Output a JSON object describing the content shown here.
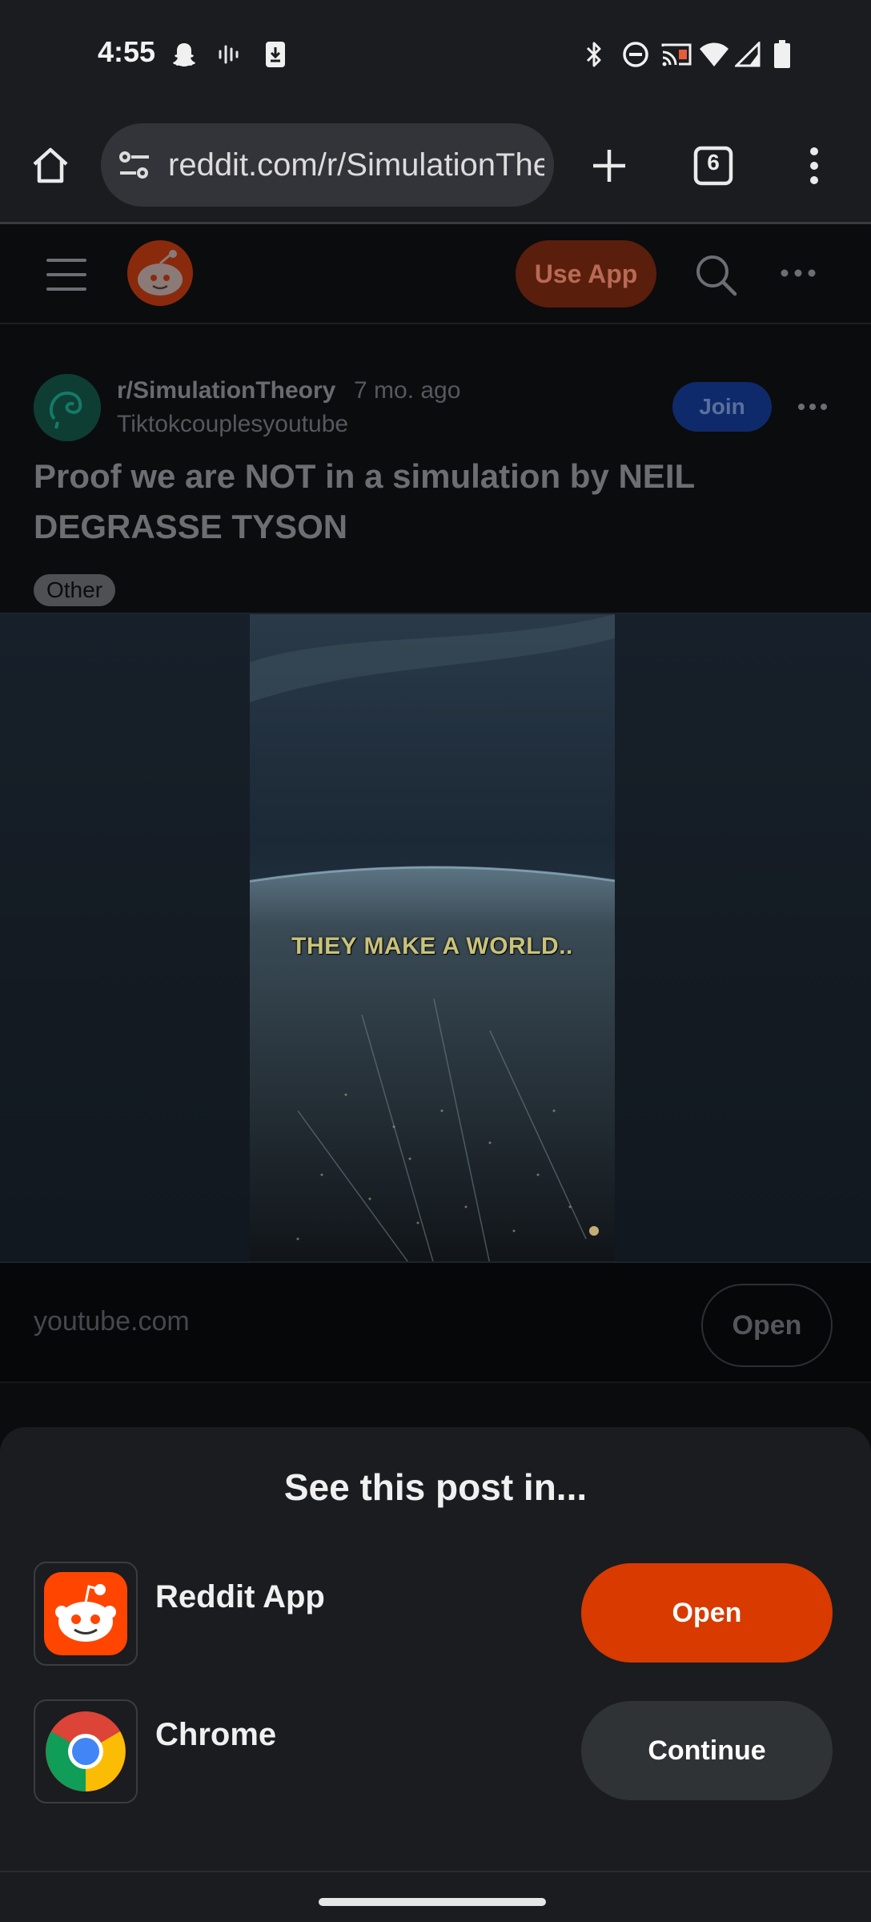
{
  "status_bar": {
    "time": "4:55",
    "left_icons": [
      "snapchat-icon",
      "voice-recorder-icon",
      "download-icon"
    ],
    "right_icons": [
      "bluetooth-icon",
      "do-not-disturb-icon",
      "cast-icon",
      "wifi-icon",
      "signal-icon",
      "battery-icon"
    ]
  },
  "browser": {
    "url": "reddit.com/r/SimulationTheory",
    "tab_count": "6",
    "icons": [
      "home-icon",
      "site-settings-icon",
      "new-tab-icon",
      "tab-switcher-icon",
      "menu-icon"
    ]
  },
  "reddit_header": {
    "use_app_label": "Use App"
  },
  "post": {
    "subreddit": "r/SimulationTheory",
    "age": "7 mo. ago",
    "author": "Tiktokcouplesyoutube",
    "join_label": "Join",
    "title": "Proof we are NOT in a simulation by NEIL DEGRASSE TYSON",
    "flair": "Other",
    "video_caption": "THEY MAKE A WORLD..",
    "link_domain": "youtube.com",
    "open_label": "Open"
  },
  "sheet": {
    "title": "See this post in...",
    "options": [
      {
        "label": "Reddit App",
        "action": "Open",
        "icon": "reddit-app-icon"
      },
      {
        "label": "Chrome",
        "action": "Continue",
        "icon": "chrome-icon"
      }
    ]
  },
  "colors": {
    "reddit_orange": "#d93a00",
    "sheet_bg": "#1a1c20",
    "continue_bg": "#2f3336"
  }
}
